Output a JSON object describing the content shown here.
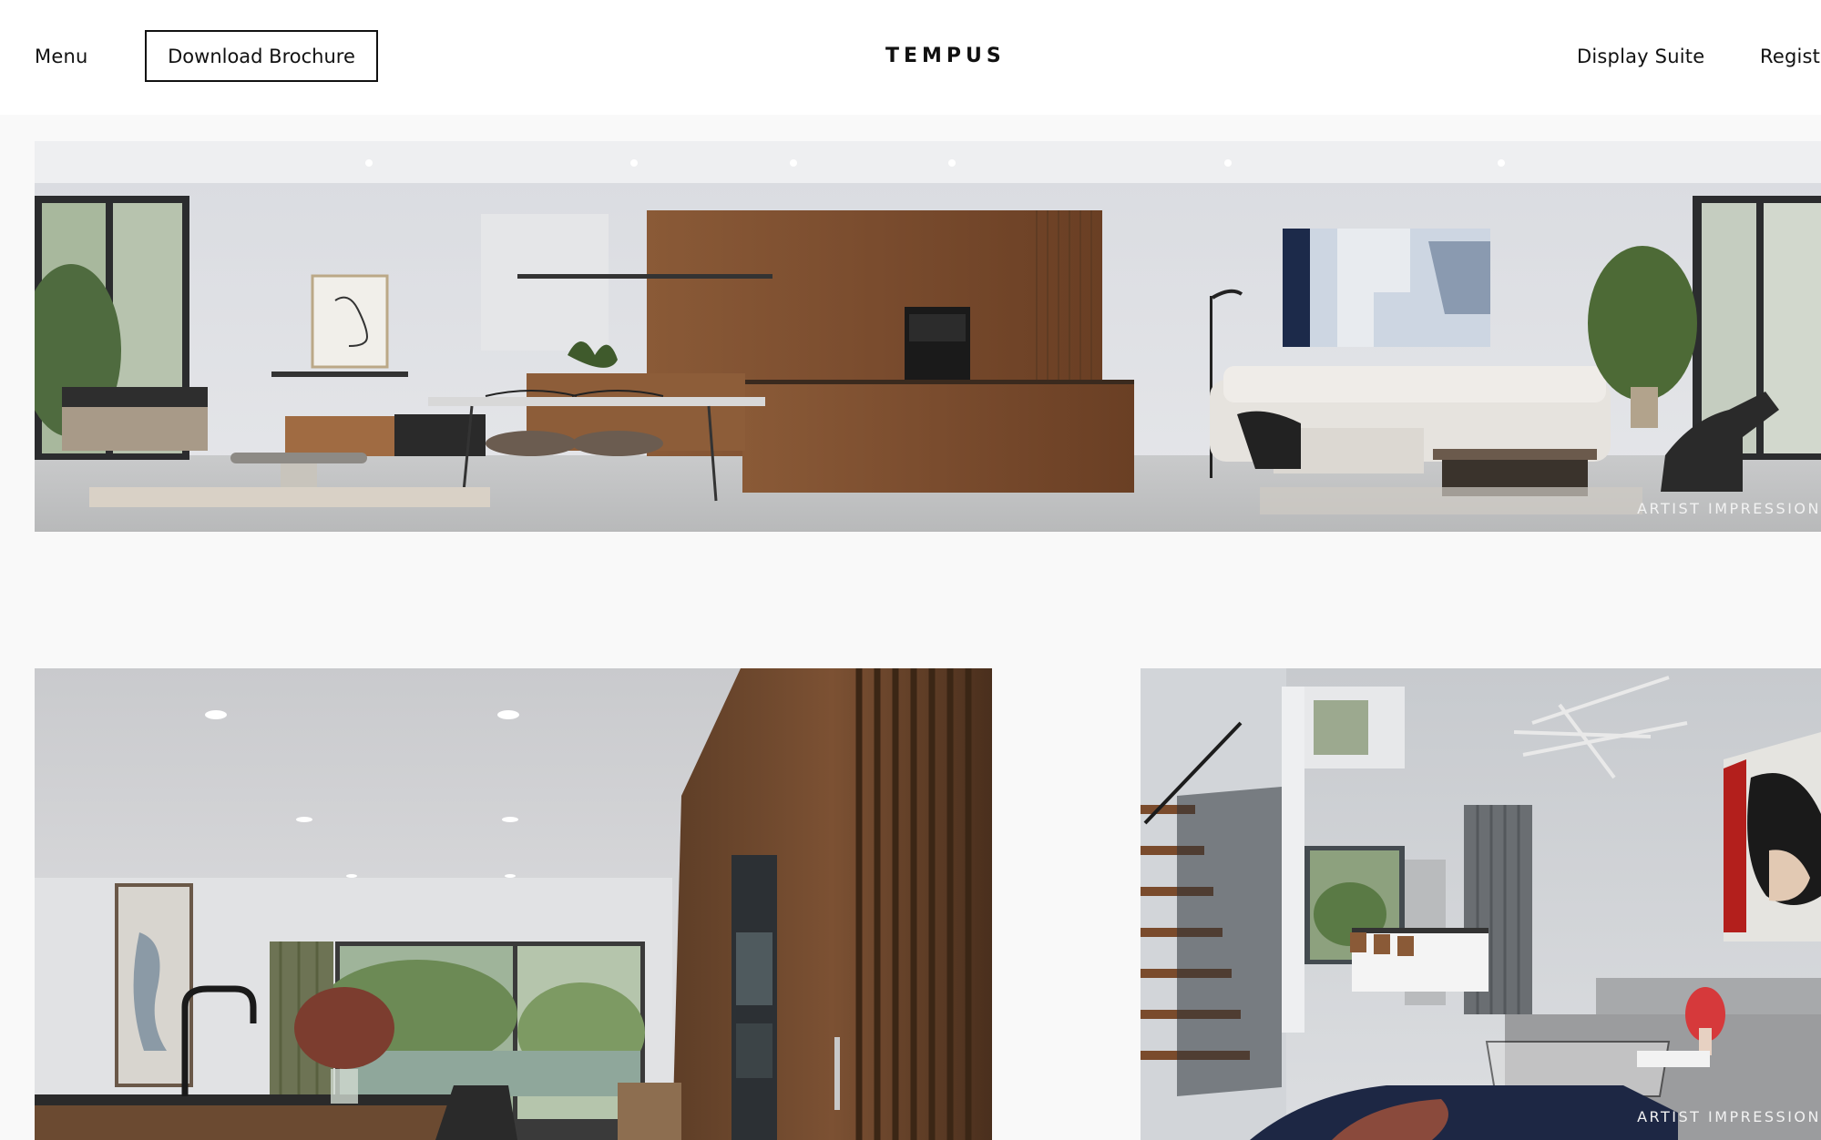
{
  "header": {
    "menu_label": "Menu",
    "brochure_label": "Download Brochure",
    "logo_text": "TEMPUS",
    "display_suite_label": "Display Suite",
    "register_label": "Regist"
  },
  "gallery": {
    "watermark": "ARTIST IMPRESSION",
    "images": [
      {
        "subject": "living-kitchen-dining-interior",
        "watermark_visible": true
      },
      {
        "subject": "kitchen-garden-view-interior",
        "watermark_visible": false
      },
      {
        "subject": "staircase-living-interior",
        "watermark_visible": true
      }
    ]
  },
  "colors": {
    "header_bg": "#ffffff",
    "page_bg": "#f9f9f9",
    "text": "#111111",
    "timber": "#7a4f31"
  }
}
